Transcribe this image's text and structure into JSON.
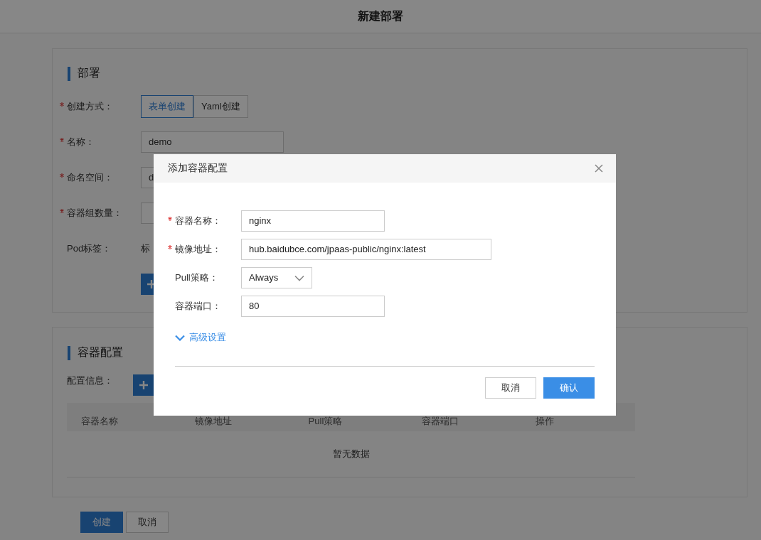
{
  "page": {
    "title": "新建部署"
  },
  "deploy_section": {
    "heading": "部署",
    "fields": [
      {
        "kind": "toggle",
        "label": "创建方式：",
        "required": true,
        "options": [
          {
            "label": "表单创建",
            "selected": true
          },
          {
            "label": "Yaml创建",
            "selected": false
          }
        ]
      },
      {
        "kind": "input",
        "label": "名称：",
        "required": true,
        "value": "demo"
      },
      {
        "kind": "input",
        "label": "命名空间：",
        "required": true,
        "value": "d"
      },
      {
        "kind": "input",
        "label": "容器组数量：",
        "required": true
      },
      {
        "kind": "text",
        "label": "Pod标签：",
        "required": false,
        "value": "标"
      }
    ]
  },
  "container_section": {
    "heading": "容器配置",
    "config_label": "配置信息：",
    "table": {
      "columns": [
        "容器名称",
        "镜像地址",
        "Pull策略",
        "容器端口",
        "操作"
      ],
      "empty_text": "暂无数据"
    }
  },
  "footer_buttons": [
    {
      "label": "创建",
      "kind": "primary"
    },
    {
      "label": "取消",
      "kind": "default"
    }
  ],
  "dialog": {
    "title": "添加容器配置",
    "fields": [
      {
        "kind": "input",
        "label": "容器名称：",
        "required": true,
        "value": "nginx"
      },
      {
        "kind": "input",
        "label": "镜像地址：",
        "required": true,
        "value": "hub.baidubce.com/jpaas-public/nginx:latest"
      },
      {
        "kind": "select",
        "label": "Pull策略：",
        "required": false,
        "value": "Always"
      },
      {
        "kind": "input",
        "label": "容器端口：",
        "required": false,
        "value": "80"
      }
    ],
    "advanced_link": "高级设置",
    "buttons": [
      {
        "label": "取消",
        "kind": "default"
      },
      {
        "label": "确认",
        "kind": "primary"
      }
    ]
  }
}
